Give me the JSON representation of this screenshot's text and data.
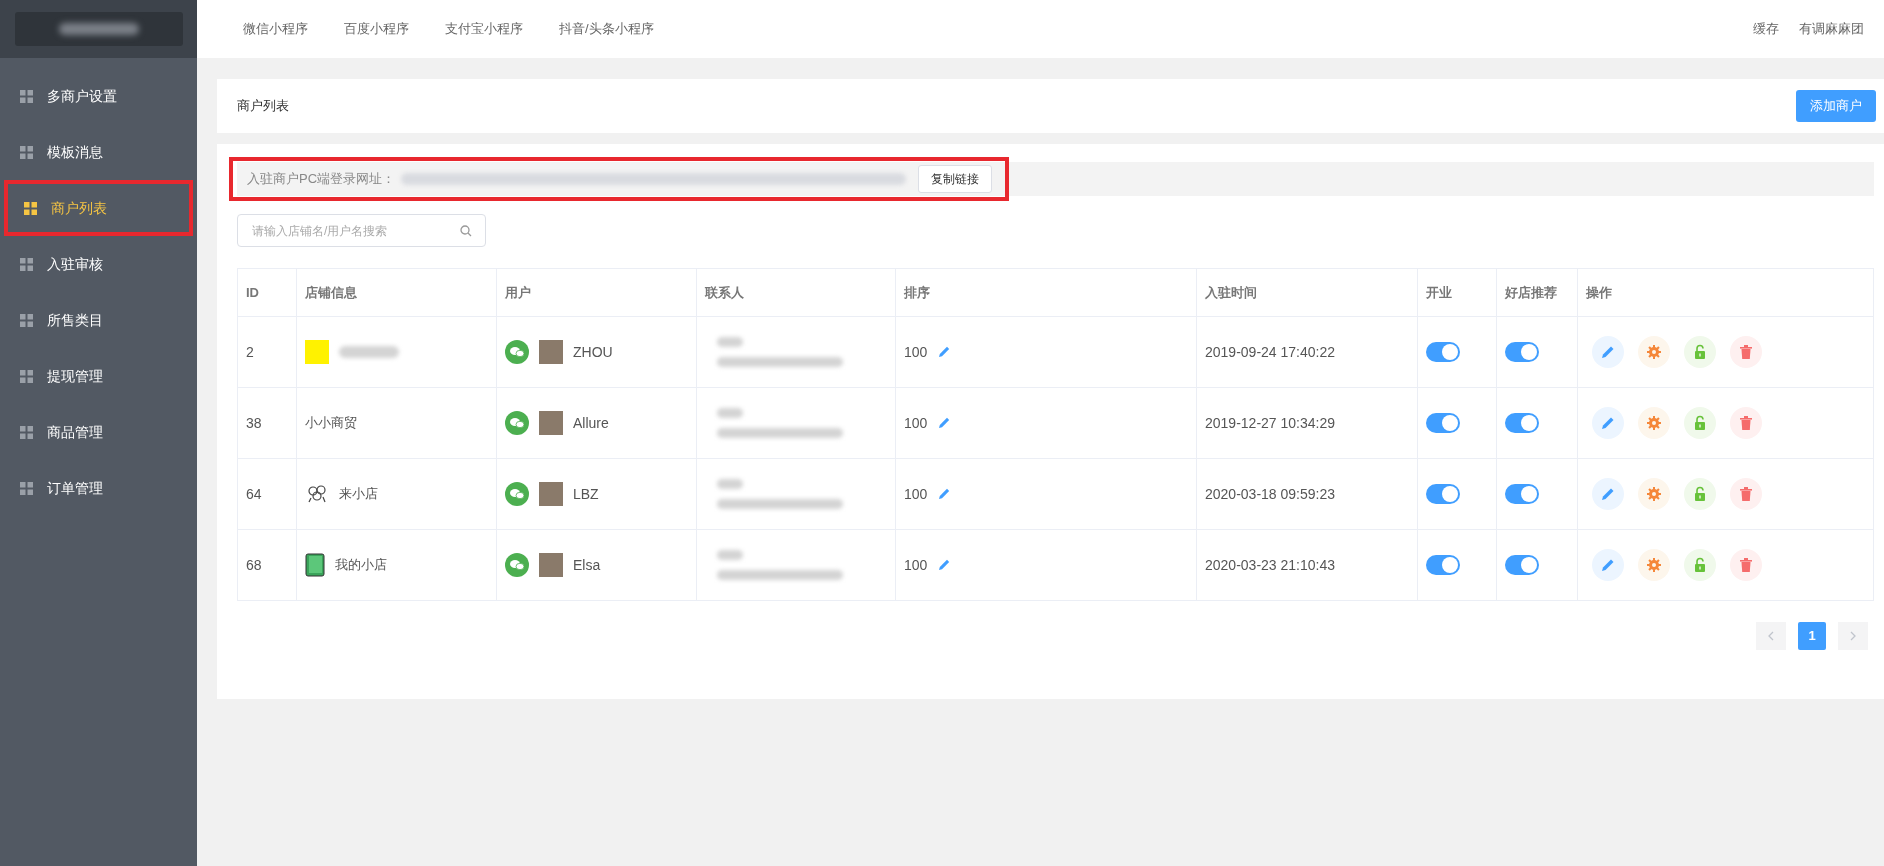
{
  "sidebar": {
    "logo_redacted": true,
    "items": [
      {
        "label": "多商户设置",
        "selected": false
      },
      {
        "label": "模板消息",
        "selected": false
      },
      {
        "label": "商户列表",
        "selected": true
      },
      {
        "label": "入驻审核",
        "selected": false
      },
      {
        "label": "所售类目",
        "selected": false
      },
      {
        "label": "提现管理",
        "selected": false
      },
      {
        "label": "商品管理",
        "selected": false
      },
      {
        "label": "订单管理",
        "selected": false
      }
    ]
  },
  "top_nav": {
    "tabs": [
      "微信小程序",
      "百度小程序",
      "支付宝小程序",
      "抖音/头条小程序"
    ],
    "right": [
      "缓存",
      "有调麻麻团"
    ]
  },
  "header": {
    "title": "商户列表",
    "add_button": "添加商户"
  },
  "login_url": {
    "label": "入驻商户PC端登录网址：",
    "url_redacted": true,
    "copy_button": "复制链接"
  },
  "search": {
    "placeholder": "请输入店铺名/用户名搜索"
  },
  "table": {
    "columns": [
      "ID",
      "店铺信息",
      "用户",
      "联系人",
      "排序",
      "入驻时间",
      "开业",
      "好店推荐",
      "操作"
    ],
    "rows": [
      {
        "id": "2",
        "kind": "square",
        "store_name_redacted": true,
        "user": "ZHOU",
        "sort": "100",
        "time": "2019-09-24 17:40:22",
        "open": true,
        "recommended": true
      },
      {
        "id": "38",
        "kind": "none",
        "store_name": "小小商贸",
        "user": "Allure",
        "sort": "100",
        "time": "2019-12-27 10:34:29",
        "open": true,
        "recommended": true
      },
      {
        "id": "64",
        "kind": "doodle",
        "store_name": "来小店",
        "user": "LBZ",
        "sort": "100",
        "time": "2020-03-18 09:59:23",
        "open": true,
        "recommended": true
      },
      {
        "id": "68",
        "kind": "book",
        "store_name": "我的小店",
        "user": "Elsa",
        "sort": "100",
        "time": "2020-03-23 21:10:43",
        "open": true,
        "recommended": true
      }
    ]
  },
  "pagination": {
    "pages": [
      {
        "label": "1",
        "selected": true
      }
    ]
  }
}
